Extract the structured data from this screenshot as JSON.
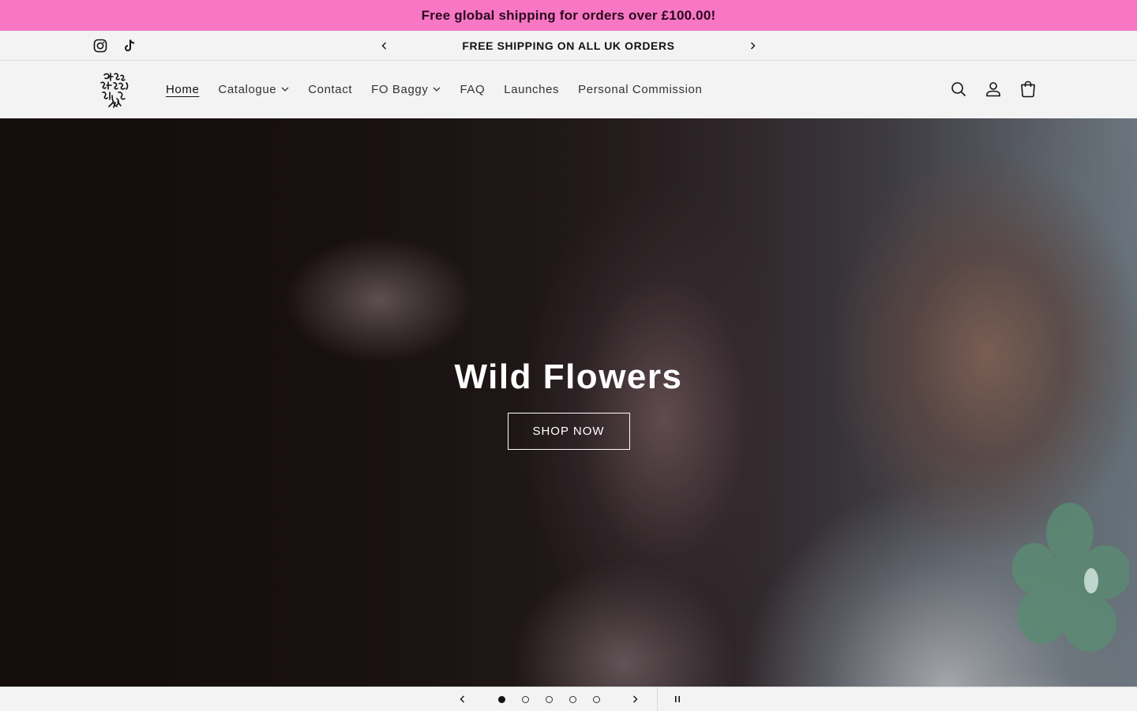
{
  "promo": {
    "text": "Free global shipping for orders over £100.00!"
  },
  "announcement": {
    "text": "FREE SHIPPING ON ALL UK ORDERS",
    "prev_icon": "chevron-left-icon",
    "next_icon": "chevron-right-icon"
  },
  "social": [
    {
      "name": "Instagram",
      "icon": "instagram-icon"
    },
    {
      "name": "TikTok",
      "icon": "tiktok-icon"
    }
  ],
  "header": {
    "logo_icon": "brand-logo",
    "nav": [
      {
        "label": "Home",
        "active": true,
        "dropdown": false
      },
      {
        "label": "Catalogue",
        "active": false,
        "dropdown": true
      },
      {
        "label": "Contact",
        "active": false,
        "dropdown": false
      },
      {
        "label": "FO Baggy",
        "active": false,
        "dropdown": true
      },
      {
        "label": "FAQ",
        "active": false,
        "dropdown": false
      },
      {
        "label": "Launches",
        "active": false,
        "dropdown": false
      },
      {
        "label": "Personal Commission",
        "active": false,
        "dropdown": false
      }
    ],
    "icons": [
      "search-icon",
      "account-icon",
      "cart-icon"
    ]
  },
  "hero": {
    "title": "Wild Flowers",
    "button_label": "SHOP NOW"
  },
  "slideshow": {
    "slide_count": 5,
    "active_slide": 1,
    "prev_icon": "chevron-left-icon",
    "next_icon": "chevron-right-icon",
    "pause_icon": "pause-icon"
  },
  "colors": {
    "promo_bg": "#f777c4",
    "page_bg": "#f3f3f3",
    "hero_text": "#ffffff"
  }
}
